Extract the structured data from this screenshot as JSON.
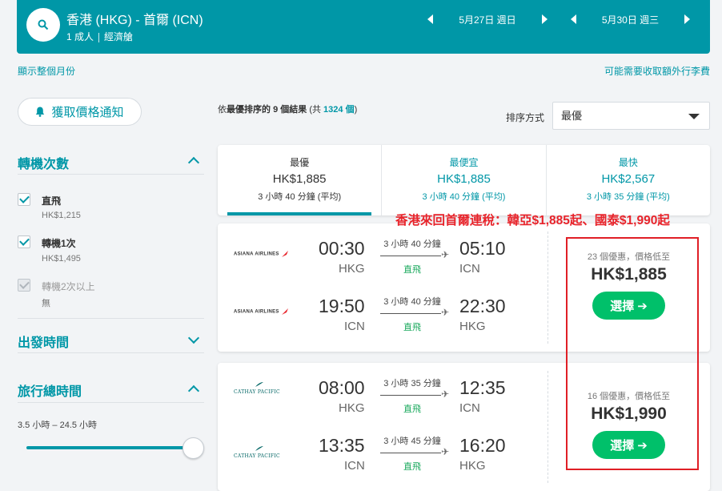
{
  "header": {
    "route": "香港 (HKG) - 首爾 (ICN)",
    "passengers": "1 成人",
    "cabin": "經濟艙",
    "depart_date": "5月27日 週日",
    "return_date": "5月30日 週三"
  },
  "links": {
    "show_month": "顯示整個月份",
    "baggage_fee": "可能需要收取額外行李費"
  },
  "sidebar": {
    "price_alert": "獲取價格通知",
    "stops_title": "轉機次數",
    "stops": [
      {
        "label": "直飛",
        "price": "HK$1,215",
        "checked": true,
        "disabled": false
      },
      {
        "label": "轉機1次",
        "price": "HK$1,495",
        "checked": true,
        "disabled": false
      },
      {
        "label": "轉機2次以上",
        "price": "無",
        "checked": true,
        "disabled": true
      }
    ],
    "departure_title": "出發時間",
    "duration_title": "旅行總時間",
    "duration_range": "3.5 小時 – 24.5 小時",
    "duration_slider_fraction": 1.0
  },
  "results": {
    "prefix": "依",
    "sorted_by": "最優排序的",
    "count_label": "9 個結果",
    "total_prefix": "(共",
    "total": "1324 個",
    "total_suffix": ")",
    "sort_label": "排序方式",
    "sort_value": "最優"
  },
  "tabs": [
    {
      "name": "最優",
      "price": "HK$1,885",
      "duration": "3 小時 40 分鐘 (平均)"
    },
    {
      "name": "最便宜",
      "price": "HK$1,885",
      "duration": "3 小時 40 分鐘 (平均)"
    },
    {
      "name": "最快",
      "price": "HK$2,567",
      "duration": "3 小時 35 分鐘 (平均)"
    }
  ],
  "annotation": "香港來回首爾連稅：韓亞$1,885起、國泰$1,990起",
  "flights": [
    {
      "airline": "ASIANA AIRLINES",
      "legs": [
        {
          "dep_time": "00:30",
          "dep_apt": "HKG",
          "duration": "3 小時 40 分鐘",
          "stops": "直飛",
          "arr_time": "05:10",
          "arr_apt": "ICN"
        },
        {
          "dep_time": "19:50",
          "dep_apt": "ICN",
          "duration": "3 小時 40 分鐘",
          "stops": "直飛",
          "arr_time": "22:30",
          "arr_apt": "HKG"
        }
      ],
      "deals": "23 個優惠，價格低至",
      "price": "HK$1,885",
      "select": "選擇"
    },
    {
      "airline": "CATHAY PACIFIC",
      "legs": [
        {
          "dep_time": "08:00",
          "dep_apt": "HKG",
          "duration": "3 小時 35 分鐘",
          "stops": "直飛",
          "arr_time": "12:35",
          "arr_apt": "ICN"
        },
        {
          "dep_time": "13:35",
          "dep_apt": "ICN",
          "duration": "3 小時 45 分鐘",
          "stops": "直飛",
          "arr_time": "16:20",
          "arr_apt": "HKG"
        }
      ],
      "deals": "16 個優惠，價格低至",
      "price": "HK$1,990",
      "select": "選擇"
    }
  ],
  "colors": {
    "accent": "#0097a7",
    "select_button": "#00c06a",
    "annotation": "#e8232a",
    "asiana": "#e8232a",
    "cathay": "#006564"
  }
}
